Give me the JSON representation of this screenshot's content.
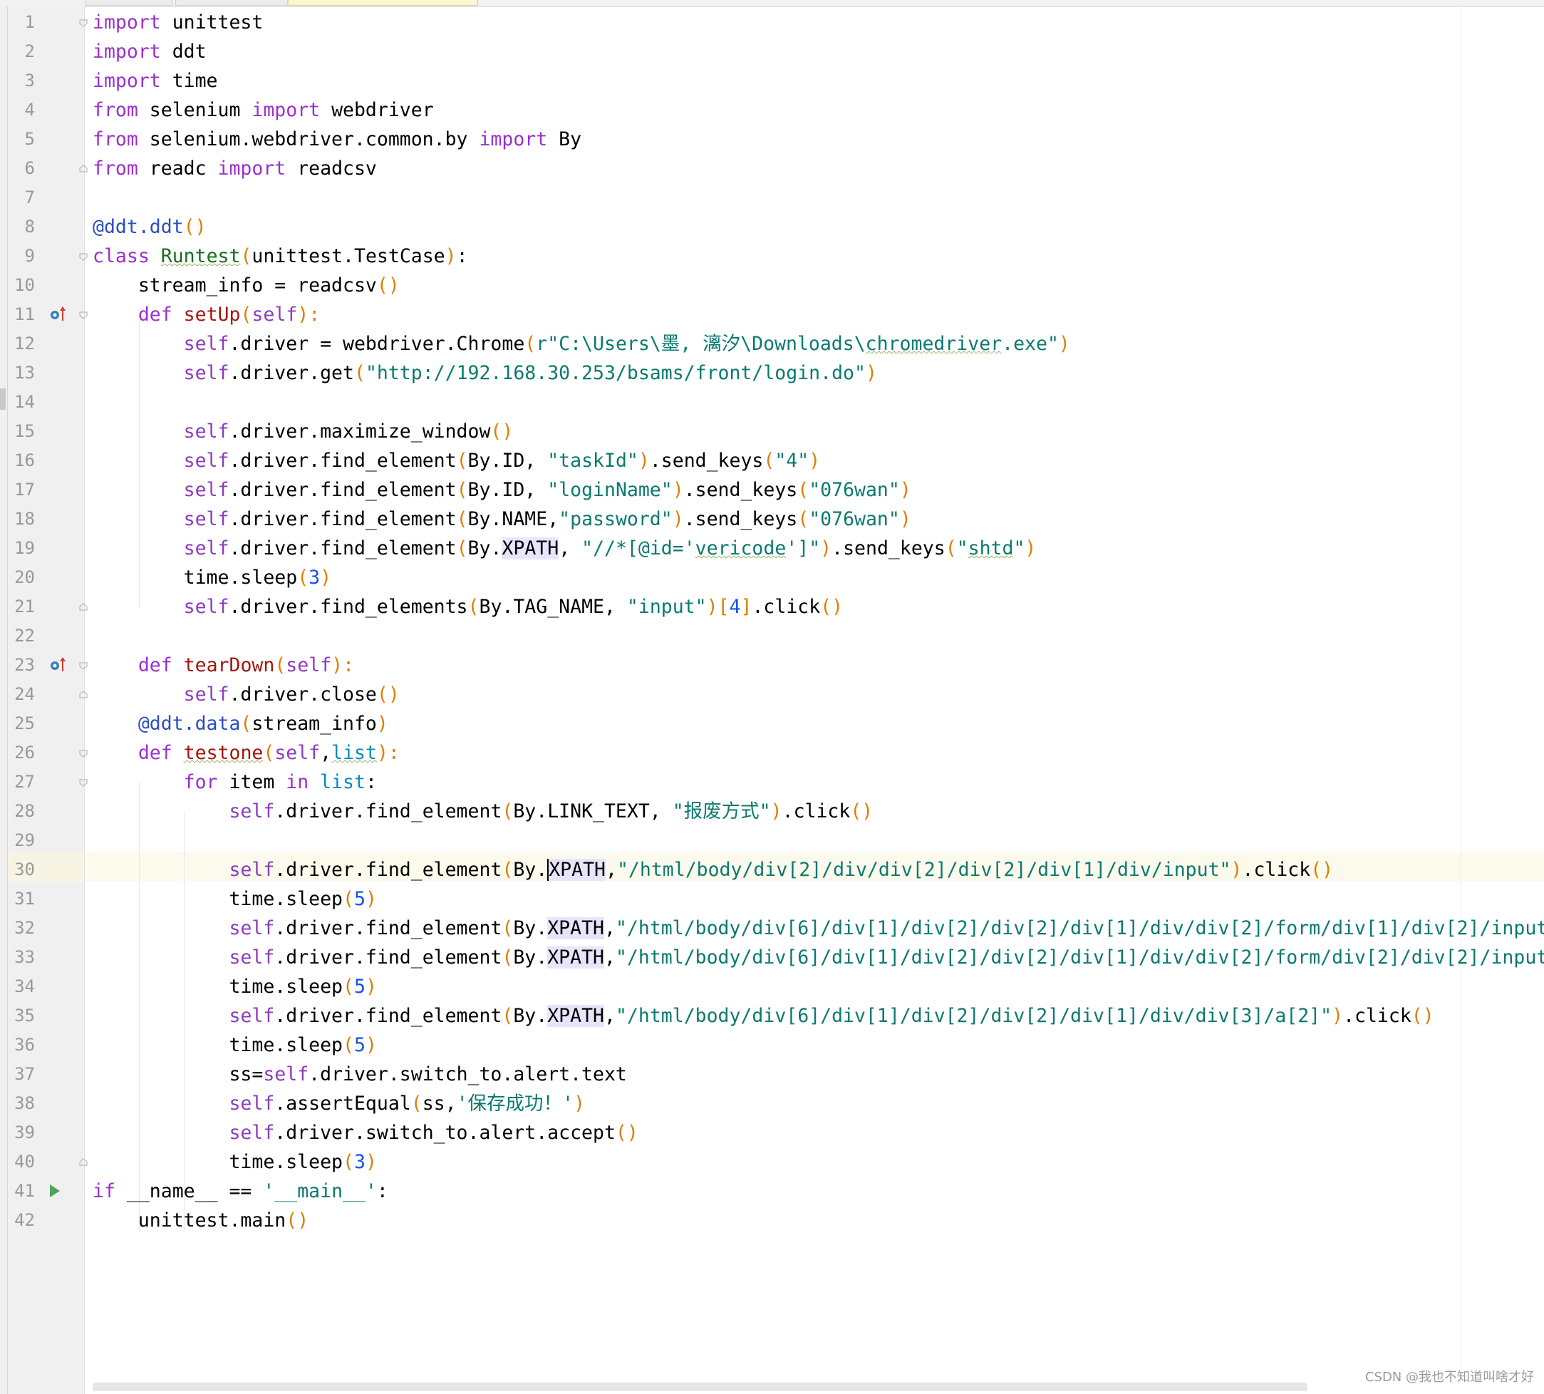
{
  "editor": {
    "current_line": 30,
    "lines": [
      {
        "n": "1"
      },
      {
        "n": "2"
      },
      {
        "n": "3"
      },
      {
        "n": "4"
      },
      {
        "n": "5"
      },
      {
        "n": "6"
      },
      {
        "n": "7"
      },
      {
        "n": "8"
      },
      {
        "n": "9"
      },
      {
        "n": "10"
      },
      {
        "n": "11"
      },
      {
        "n": "12"
      },
      {
        "n": "13"
      },
      {
        "n": "14"
      },
      {
        "n": "15"
      },
      {
        "n": "16"
      },
      {
        "n": "17"
      },
      {
        "n": "18"
      },
      {
        "n": "19"
      },
      {
        "n": "20"
      },
      {
        "n": "21"
      },
      {
        "n": "22"
      },
      {
        "n": "23"
      },
      {
        "n": "24"
      },
      {
        "n": "25"
      },
      {
        "n": "26"
      },
      {
        "n": "27"
      },
      {
        "n": "28"
      },
      {
        "n": "29"
      },
      {
        "n": "30"
      },
      {
        "n": "31"
      },
      {
        "n": "32"
      },
      {
        "n": "33"
      },
      {
        "n": "34"
      },
      {
        "n": "35"
      },
      {
        "n": "36"
      },
      {
        "n": "37"
      },
      {
        "n": "38"
      },
      {
        "n": "39"
      },
      {
        "n": "40"
      },
      {
        "n": "41"
      },
      {
        "n": "42"
      }
    ],
    "code": {
      "l1": [
        "import",
        " unittest"
      ],
      "l2": [
        "import",
        " ddt"
      ],
      "l3": [
        "import",
        " time"
      ],
      "l4": [
        "from",
        " selenium ",
        "import",
        " webdriver"
      ],
      "l5": [
        "from",
        " selenium.webdriver.common.by ",
        "import",
        " By"
      ],
      "l6": [
        "from",
        " readc ",
        "import",
        " readcsv"
      ],
      "l8": [
        "@ddt.ddt",
        "()"
      ],
      "l9": [
        "class",
        " ",
        "Runtest",
        "(",
        "unittest.TestCase",
        ")",
        ":"
      ],
      "l10": [
        "    stream_info = readcsv",
        "()"
      ],
      "l11": [
        "    ",
        "def",
        " ",
        "setUp",
        "(",
        "self",
        "):"
      ],
      "l12": [
        "        ",
        "self",
        ".driver = webdriver.Chrome",
        "(",
        "r\"C:\\Users\\墨, 漓汐\\Downloads\\",
        "chromedriver",
        ".exe\"",
        ")"
      ],
      "l13": [
        "        ",
        "self",
        ".driver.get",
        "(",
        "\"http://192.168.30.253/bsams/front/login.do\"",
        ")"
      ],
      "l15": [
        "        ",
        "self",
        ".driver.maximize_window",
        "()"
      ],
      "l16": [
        "        ",
        "self",
        ".driver.find_element",
        "(",
        "By.ID, ",
        "\"taskId\"",
        ")",
        ".send_keys",
        "(",
        "\"4\"",
        ")"
      ],
      "l17": [
        "        ",
        "self",
        ".driver.find_element",
        "(",
        "By.ID, ",
        "\"loginName\"",
        ")",
        ".send_keys",
        "(",
        "\"076wan\"",
        ")"
      ],
      "l18": [
        "        ",
        "self",
        ".driver.find_element",
        "(",
        "By.NAME,",
        "\"password\"",
        ")",
        ".send_keys",
        "(",
        "\"076wan\"",
        ")"
      ],
      "l19": [
        "        ",
        "self",
        ".driver.find_element",
        "(",
        "By.",
        "XPATH",
        ", ",
        "\"//*[@id='",
        "vericode",
        "']\"",
        ")",
        ".send_keys",
        "(",
        "\"",
        "shtd",
        "\"",
        ")"
      ],
      "l20": [
        "        time.sleep",
        "(",
        "3",
        ")"
      ],
      "l21": [
        "        ",
        "self",
        ".driver.find_elements",
        "(",
        "By.TAG_NAME, ",
        "\"input\"",
        ")[",
        "4",
        "]",
        ".click",
        "()"
      ],
      "l23": [
        "    ",
        "def",
        " ",
        "tearDown",
        "(",
        "self",
        "):"
      ],
      "l24": [
        "        ",
        "self",
        ".driver.close",
        "()"
      ],
      "l25": [
        "    ",
        "@ddt.data",
        "(",
        "stream_info",
        ")"
      ],
      "l26": [
        "    ",
        "def",
        " ",
        "testone",
        "(",
        "self",
        ",",
        "list",
        "):"
      ],
      "l27": [
        "        ",
        "for",
        " item ",
        "in",
        " ",
        "list",
        ":"
      ],
      "l28": [
        "            ",
        "self",
        ".driver.find_element",
        "(",
        "By.LINK_TEXT, ",
        "\"报废方式\"",
        ")",
        ".click",
        "()"
      ],
      "l30": [
        "            ",
        "self",
        ".driver.find_element",
        "(",
        "By.",
        "XPATH",
        ",",
        "\"/html/body/div[2]/div/div[2]/div[2]/div[1]/div/input\"",
        ")",
        ".click",
        "()"
      ],
      "l31": [
        "            time.sleep",
        "(",
        "5",
        ")"
      ],
      "l32": [
        "            ",
        "self",
        ".driver.find_element",
        "(",
        "By.",
        "XPATH",
        ",",
        "\"/html/body/div[6]/div[1]/div[2]/div[2]/div[1]/div/div[2]/form/div[1]/div[2]/input"
      ],
      "l33": [
        "            ",
        "self",
        ".driver.find_element",
        "(",
        "By.",
        "XPATH",
        ",",
        "\"/html/body/div[6]/div[1]/div[2]/div[2]/div[1]/div/div[2]/form/div[2]/div[2]/input"
      ],
      "l34": [
        "            time.sleep",
        "(",
        "5",
        ")"
      ],
      "l35": [
        "            ",
        "self",
        ".driver.find_element",
        "(",
        "By.",
        "XPATH",
        ",",
        "\"/html/body/div[6]/div[1]/div[2]/div[2]/div[1]/div/div[3]/a[2]\"",
        ")",
        ".click",
        "()"
      ],
      "l36": [
        "            time.sleep",
        "(",
        "5",
        ")"
      ],
      "l37": [
        "            ss=",
        "self",
        ".driver.switch_to.alert.text"
      ],
      "l38": [
        "            ",
        "self",
        ".assertEqual",
        "(",
        "ss,",
        "'保存成功！'",
        ")"
      ],
      "l39": [
        "            ",
        "self",
        ".driver.switch_to.alert.accept",
        "()"
      ],
      "l40": [
        "            time.sleep",
        "(",
        "3",
        ")"
      ],
      "l41": [
        "if",
        " __name__ == ",
        "'__main__'",
        ":"
      ],
      "l42": [
        "    unittest.main",
        "()"
      ]
    }
  },
  "colors": {
    "keyword": "#9b30d0",
    "string": "#0a7a6e",
    "paren": "#e07e00",
    "number": "#1750eb",
    "current_line_bg": "#fcfaed"
  },
  "icons": {
    "override_up": "override-up-icon",
    "run": "run-icon",
    "fold": "fold-icon"
  },
  "watermark": "CSDN @我也不知道叫啥才好"
}
